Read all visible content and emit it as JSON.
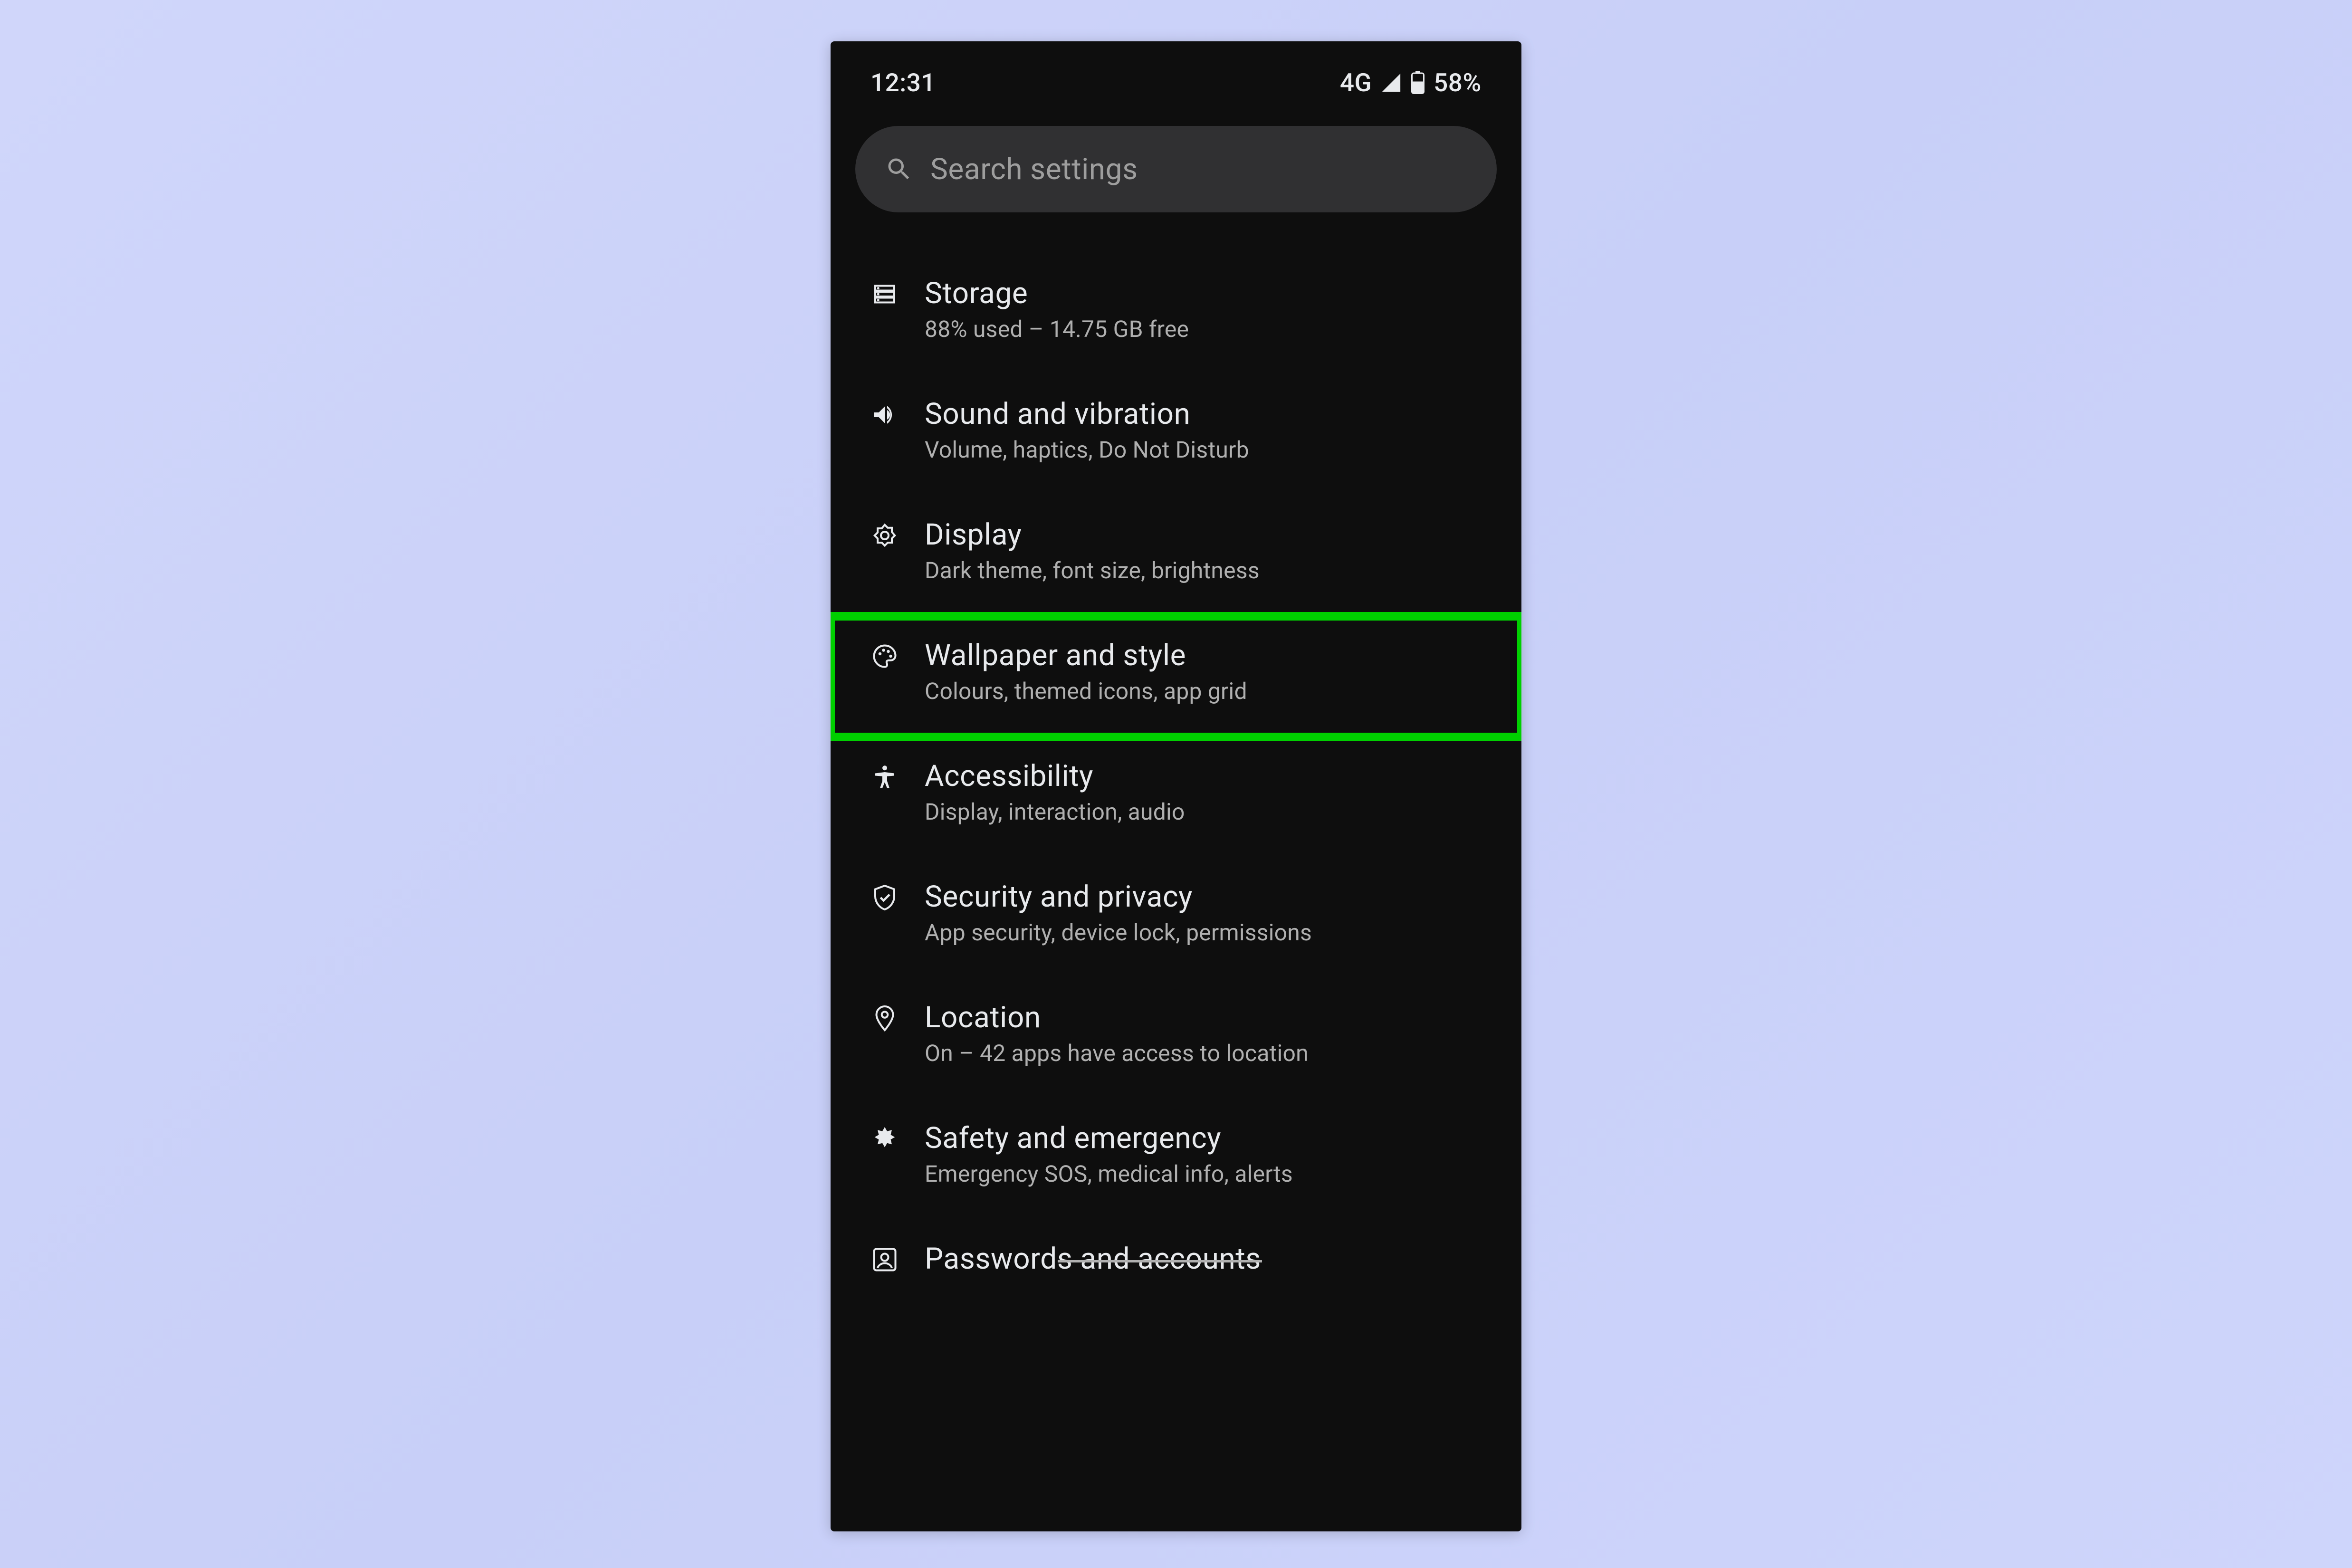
{
  "status": {
    "time": "12:31",
    "network": "4G",
    "battery": "58%"
  },
  "search": {
    "placeholder": "Search settings"
  },
  "items": [
    {
      "id": "storage",
      "title": "Storage",
      "sub": "88% used – 14.75 GB free"
    },
    {
      "id": "sound",
      "title": "Sound and vibration",
      "sub": "Volume, haptics, Do Not Disturb"
    },
    {
      "id": "display",
      "title": "Display",
      "sub": "Dark theme, font size, brightness"
    },
    {
      "id": "wallpaper",
      "title": "Wallpaper and style",
      "sub": "Colours, themed icons, app grid"
    },
    {
      "id": "accessibility",
      "title": "Accessibility",
      "sub": "Display, interaction, audio"
    },
    {
      "id": "security",
      "title": "Security and privacy",
      "sub": "App security, device lock, permissions"
    },
    {
      "id": "location",
      "title": "Location",
      "sub": "On – 42 apps have access to location"
    },
    {
      "id": "safety",
      "title": "Safety and emergency",
      "sub": "Emergency SOS, medical info, alerts"
    },
    {
      "id": "passwords",
      "title": "Passwords and accounts",
      "sub": ""
    }
  ],
  "highlight_id": "wallpaper"
}
